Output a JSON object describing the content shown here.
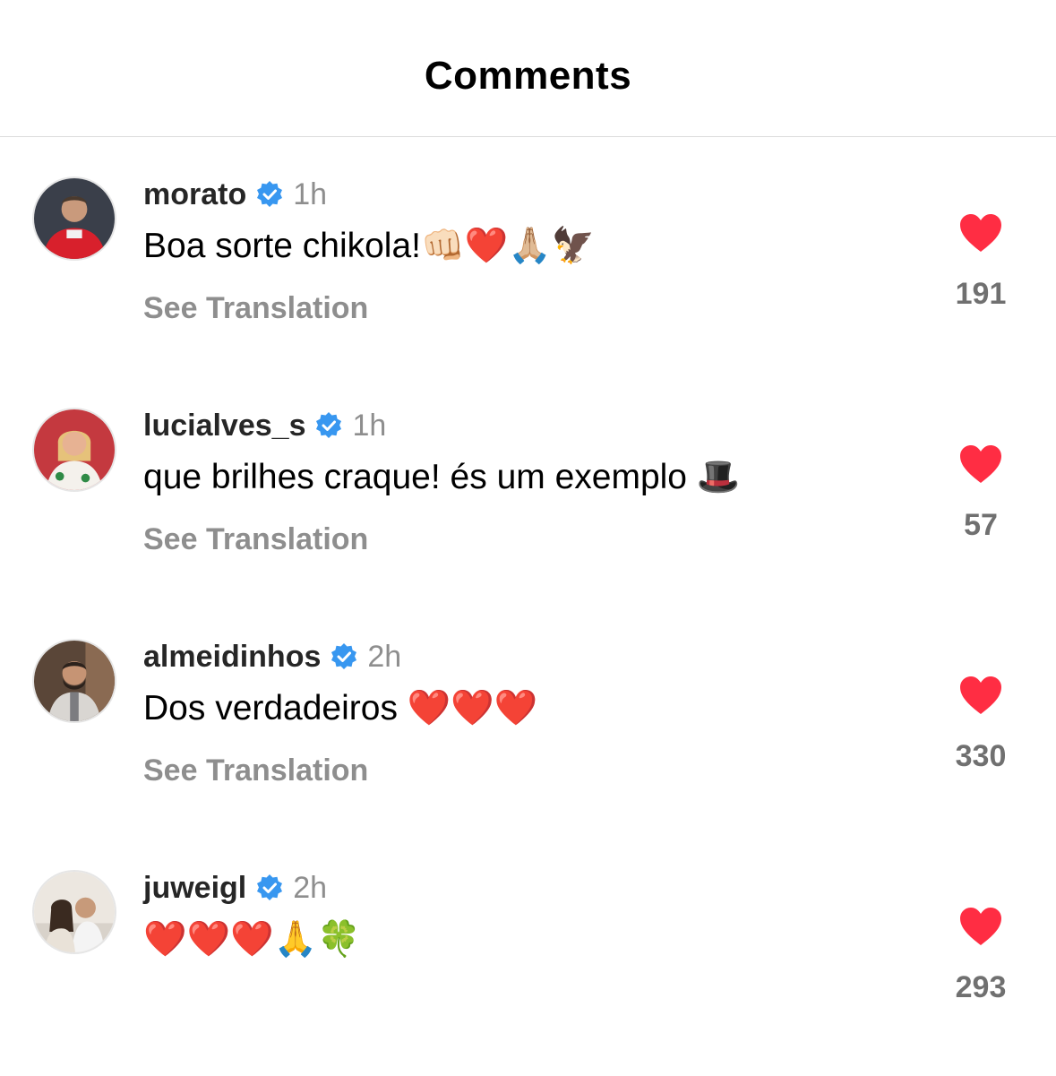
{
  "header": {
    "title": "Comments"
  },
  "colors": {
    "verified": "#3897f0",
    "like": "#ff2d43",
    "muted": "#8e8e8e"
  },
  "comments": [
    {
      "username": "morato",
      "verified": true,
      "time": "1h",
      "text": "Boa sorte chikola!👊🏻❤️🙏🏼🦅",
      "translate_label": "See Translation",
      "like_icon": "heart-icon",
      "likes": "191"
    },
    {
      "username": "lucialves_s",
      "verified": true,
      "time": "1h",
      "text": "que brilhes craque! és um exemplo 🎩",
      "translate_label": "See Translation",
      "like_icon": "heart-icon",
      "likes": "57"
    },
    {
      "username": "almeidinhos",
      "verified": true,
      "time": "2h",
      "text": "Dos verdadeiros ❤️❤️❤️",
      "translate_label": "See Translation",
      "like_icon": "heart-icon",
      "likes": "330"
    },
    {
      "username": "juweigl",
      "verified": true,
      "time": "2h",
      "text": "❤️❤️❤️🙏🍀",
      "like_icon": "heart-icon",
      "likes": "293"
    }
  ]
}
